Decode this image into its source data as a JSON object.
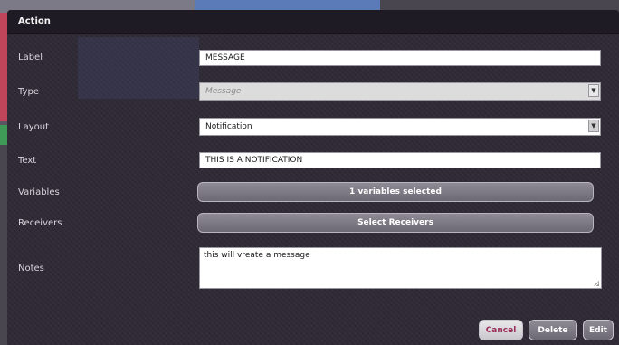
{
  "dialog": {
    "title": "Action"
  },
  "fields": {
    "label": {
      "label": "Label",
      "value": "MESSAGE"
    },
    "type": {
      "label": "Type",
      "value": "Message"
    },
    "layout": {
      "label": "Layout",
      "value": "Notification"
    },
    "text": {
      "label": "Text",
      "value": "THIS IS A NOTIFICATION"
    },
    "variables": {
      "label": "Variables",
      "button": "1 variables selected"
    },
    "receivers": {
      "label": "Receivers",
      "button": "Select Receivers"
    },
    "notes": {
      "label": "Notes",
      "value": "this will vreate a message"
    }
  },
  "footer": {
    "cancel": "Cancel",
    "delete": "Delete",
    "edit": "Edit"
  },
  "colors": {
    "modal_bg": "#2f2a35",
    "header_bg": "#1f1b24",
    "cancel_text": "#9a2f5a"
  },
  "icons": {
    "dropdown": "chevron-down-icon",
    "resize": "resize-grip-icon"
  }
}
